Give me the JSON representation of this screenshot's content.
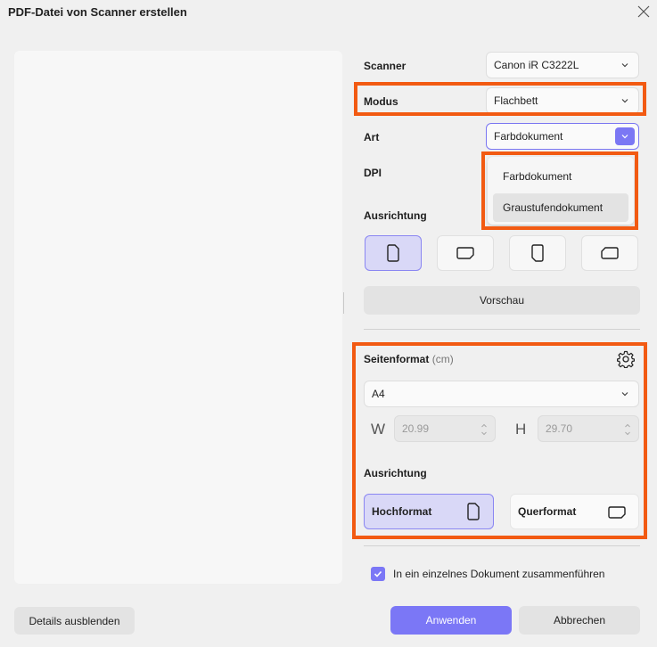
{
  "dialog": {
    "title": "PDF-Datei von Scanner erstellen"
  },
  "scanner": {
    "label": "Scanner",
    "value": "Canon iR C3222L"
  },
  "mode": {
    "label": "Modus",
    "value": "Flachbett"
  },
  "type": {
    "label": "Art",
    "value": "Farbdokument",
    "options": [
      "Farbdokument",
      "Graustufendokument"
    ]
  },
  "dpi": {
    "label": "DPI"
  },
  "orientation": {
    "label": "Ausrichtung"
  },
  "preview_button": "Vorschau",
  "page_format": {
    "label": "Seitenformat",
    "unit": "(cm)",
    "size": "A4",
    "width_label": "W",
    "width_value": "20.99",
    "height_label": "H",
    "height_value": "29.70",
    "orientation_label": "Ausrichtung",
    "portrait_label": "Hochformat",
    "landscape_label": "Querformat"
  },
  "merge_checkbox": {
    "label": "In ein einzelnes Dokument zusammenführen",
    "checked": true
  },
  "footer": {
    "details_button": "Details ausblenden",
    "apply_button": "Anwenden",
    "cancel_button": "Abbrechen"
  },
  "colors": {
    "accent": "#7b77f6",
    "highlight": "#f25a12"
  }
}
